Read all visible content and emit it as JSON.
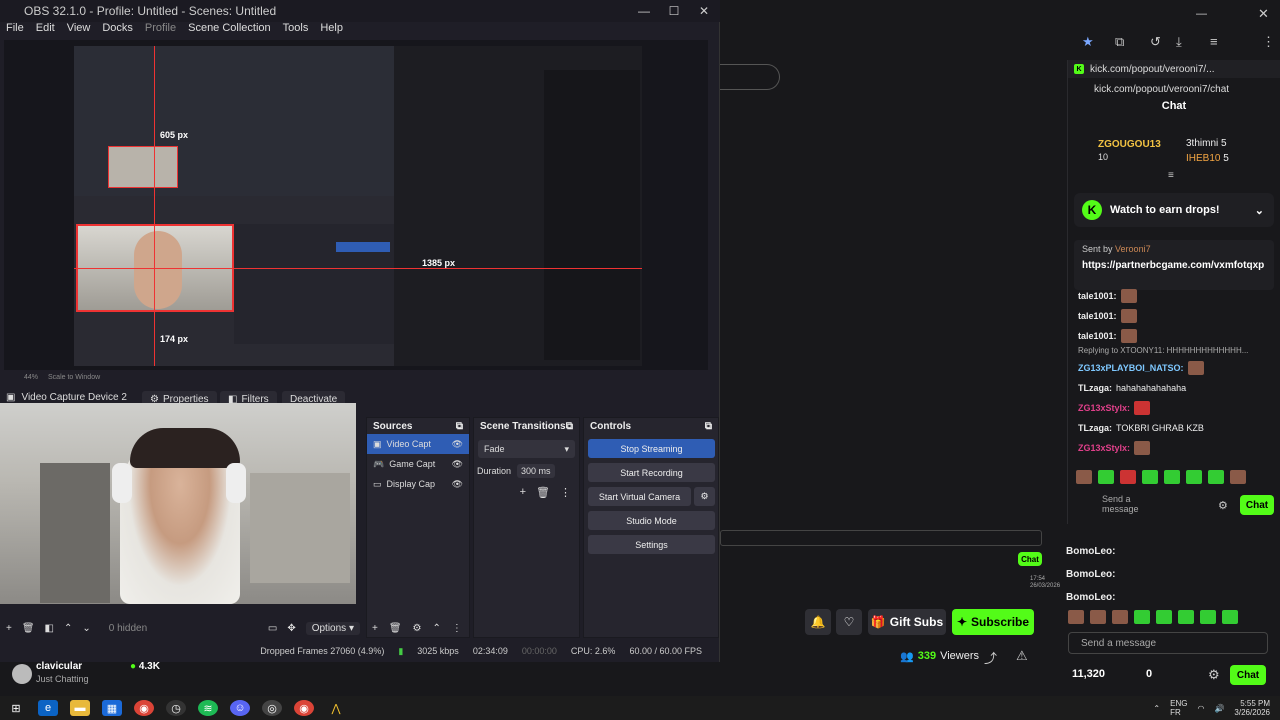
{
  "obs": {
    "title": "OBS 32.1.0 - Profile: Untitled - Scenes: Untitled",
    "menu": [
      "File",
      "Edit",
      "View",
      "Docks",
      "Profile",
      "Scene Collection",
      "Tools",
      "Help"
    ],
    "preview_labels": {
      "w": "605 px",
      "h_right": "1385 px",
      "bottom": "174 px"
    },
    "zoom": "44%",
    "scale_label": "Scale to Window",
    "context": {
      "source": "Video Capture Device 2",
      "properties": "Properties",
      "filters": "Filters",
      "deactivate": "Deactivate"
    },
    "sources": {
      "title": "Sources",
      "items": [
        "Video Capt",
        "Game Capt",
        "Display Cap"
      ]
    },
    "transitions": {
      "title": "Scene Transitions",
      "type": "Fade",
      "duration_label": "Duration",
      "duration": "300 ms"
    },
    "controls": {
      "title": "Controls",
      "buttons": [
        "Stop Streaming",
        "Start Recording",
        "Start Virtual Camera",
        "Studio Mode",
        "Settings"
      ]
    },
    "bottom": {
      "hidden": "0 hidden",
      "options": "Options"
    },
    "status": {
      "dropped": "Dropped Frames 27060 (4.9%)",
      "kbps": "3025 kbps",
      "live": "02:34:09",
      "rec": "00:00:00",
      "cpu": "CPU: 2.6%",
      "fps": "60.00 / 60.00 FPS"
    }
  },
  "chat": {
    "url": "kick.com/popout/verooni7/...",
    "url_full": "kick.com/popout/verooni7/chat",
    "header": "Chat",
    "top_gifters": [
      {
        "name": "ZGOUGOU13",
        "count": "10"
      },
      {
        "name": "3thimni",
        "count": "5"
      },
      {
        "name": "IHEB10",
        "count": "5"
      }
    ],
    "drops": "Watch to earn drops!",
    "pinned_by": "Sent by",
    "pinned_user": "Verooni7",
    "pinned_link": "https://partnerbcgame.com/vxmfotqxp",
    "messages": [
      {
        "user": "tale1001:",
        "text": ""
      },
      {
        "user": "tale1001:",
        "text": ""
      },
      {
        "user": "tale1001:",
        "text": ""
      },
      {
        "user": "ZG13xPLAYBOI_NATSO:",
        "text": ""
      },
      {
        "user": "TLzaga:",
        "text": "hahahahahahaha"
      },
      {
        "user": "ZG13xStylx:",
        "text": ""
      },
      {
        "user": "TLzaga:",
        "text": "TOKBRI GHRAB KZB"
      },
      {
        "user": "ZG13xStylx:",
        "text": ""
      }
    ],
    "reply": "Replying to XTOONY11: HHHHHHHHHHHHH...",
    "send_placeholder": "Send a message",
    "chat_button": "Chat"
  },
  "stream": {
    "bomo": [
      "BomoLeo:",
      "BomoLeo:",
      "BomoLeo:"
    ],
    "gift_subs": "Gift Subs",
    "subscribe": "Subscribe",
    "viewers": "339",
    "viewers_label": "Viewers",
    "send_placeholder": "Send a message",
    "points": "11,320",
    "zero": "0",
    "chat_button": "Chat",
    "time_small": "17:54",
    "date_small": "26/03/2026",
    "streamer": "clavicular",
    "category": "Just Chatting",
    "streamer_viewers": "4.3K"
  },
  "taskbar": {
    "lang1": "ENG",
    "lang2": "FR",
    "time": "5:55 PM",
    "date": "3/26/2026"
  },
  "colors": {
    "kick_green": "#53fc18",
    "obs_blue": "#2f5db4"
  }
}
